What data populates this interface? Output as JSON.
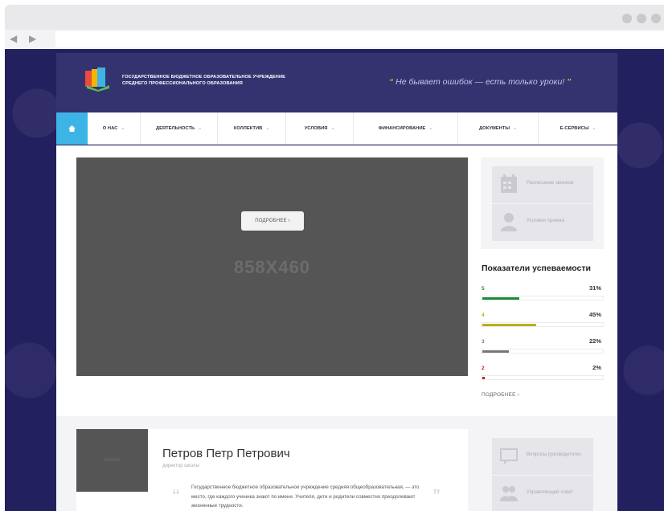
{
  "browser": {
    "back_icon": "triangle-left",
    "forward_icon": "triangle-right"
  },
  "header": {
    "org_line1": "ГОСУДАРСТВЕННОЕ БЮДЖЕТНОЕ ОБРАЗОВАТЕЛЬНОЕ УЧРЕЖДЕНИЕ",
    "org_line2": "СРЕДНЕГО ПРОФЕССИОНАЛЬНОГО ОБРАЗОВАНИЯ",
    "motto": "Не бывает ошибок — есть только уроки!"
  },
  "nav": {
    "home_icon": "home-icon",
    "items": [
      {
        "label": "О НАС"
      },
      {
        "label": "ДЕЯТЕЛЬНОСТЬ"
      },
      {
        "label": "КОЛЛЕКТИВ"
      },
      {
        "label": "УСЛОВИЯ"
      },
      {
        "label": "ФИНАНСИРОВАНИЕ"
      },
      {
        "label": "ДОКУМЕНТЫ"
      },
      {
        "label": "Е-СЕРВИСЫ"
      }
    ]
  },
  "slider": {
    "button_label": "ПОДРОБНЕЕ ›",
    "placeholder": "858X460"
  },
  "sidebar_top": [
    {
      "label": "Расписание звонков",
      "icon": "calendar-icon"
    },
    {
      "label": "Условия приема",
      "icon": "person-icon"
    }
  ],
  "performance": {
    "title": "Показатели успеваемости",
    "rows": [
      {
        "grade": "5",
        "pct": "31%",
        "value": 0.31,
        "color": "#1f8a3a"
      },
      {
        "grade": "4",
        "pct": "45%",
        "value": 0.45,
        "color": "#b7b018"
      },
      {
        "grade": "3",
        "pct": "22%",
        "value": 0.22,
        "color": "#777777"
      },
      {
        "grade": "2",
        "pct": "2%",
        "value": 0.02,
        "color": "#b4231f"
      }
    ],
    "more": "ПОДРОБНЕЕ ›"
  },
  "director": {
    "photo_placeholder": "555X480",
    "name": "Петров Петр Петрович",
    "role": "директор школы",
    "text": "Государственное бюджетное образовательное учреждение средняя общеобразовательная, — это место, где каждого ученика знают по имени. Учителя, дети и родители совместно преодолевают жизненные трудности."
  },
  "sidebar_bottom": [
    {
      "label": "Вопросы руководителю",
      "icon": "chat-icon"
    },
    {
      "label": "Управляющий совет",
      "icon": "group-icon"
    }
  ],
  "colors": {
    "brand_dark": "#232060",
    "header": "#34336f",
    "accent": "#3db4e6"
  }
}
